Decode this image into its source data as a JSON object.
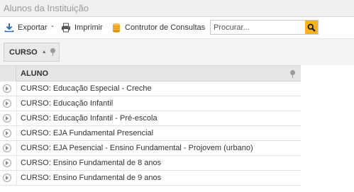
{
  "panel": {
    "title": "Alunos da Instituição"
  },
  "toolbar": {
    "export_label": "Exportar",
    "export_icon": "download-icon",
    "separator": "-",
    "print_label": "Imprimir",
    "print_icon": "printer-icon",
    "query_builder_label": "Contrutor de Consultas",
    "query_builder_icon": "database-icon"
  },
  "search": {
    "placeholder": "Procurar...",
    "button_icon": "search-icon",
    "accent": "#f6b321"
  },
  "groupbar": {
    "chip_label": "CURSO",
    "sort_icon": "sort-ascending-icon",
    "pin_icon": "pin-icon"
  },
  "grid": {
    "column_header": "ALUNO",
    "rows": [
      {
        "text": "CURSO: Educação Especial - Creche"
      },
      {
        "text": "CURSO: Educação Infantil"
      },
      {
        "text": "CURSO: Educação Infantil - Pré-escola"
      },
      {
        "text": "CURSO: EJA Fundamental Presencial"
      },
      {
        "text": "CURSO: EJA Pesencial - Ensino Fundamental - Projovem (urbano)"
      },
      {
        "text": "CURSO: Ensino Fundamental de 8 anos"
      },
      {
        "text": "CURSO: Ensino Fundamental de 9 anos"
      }
    ]
  }
}
